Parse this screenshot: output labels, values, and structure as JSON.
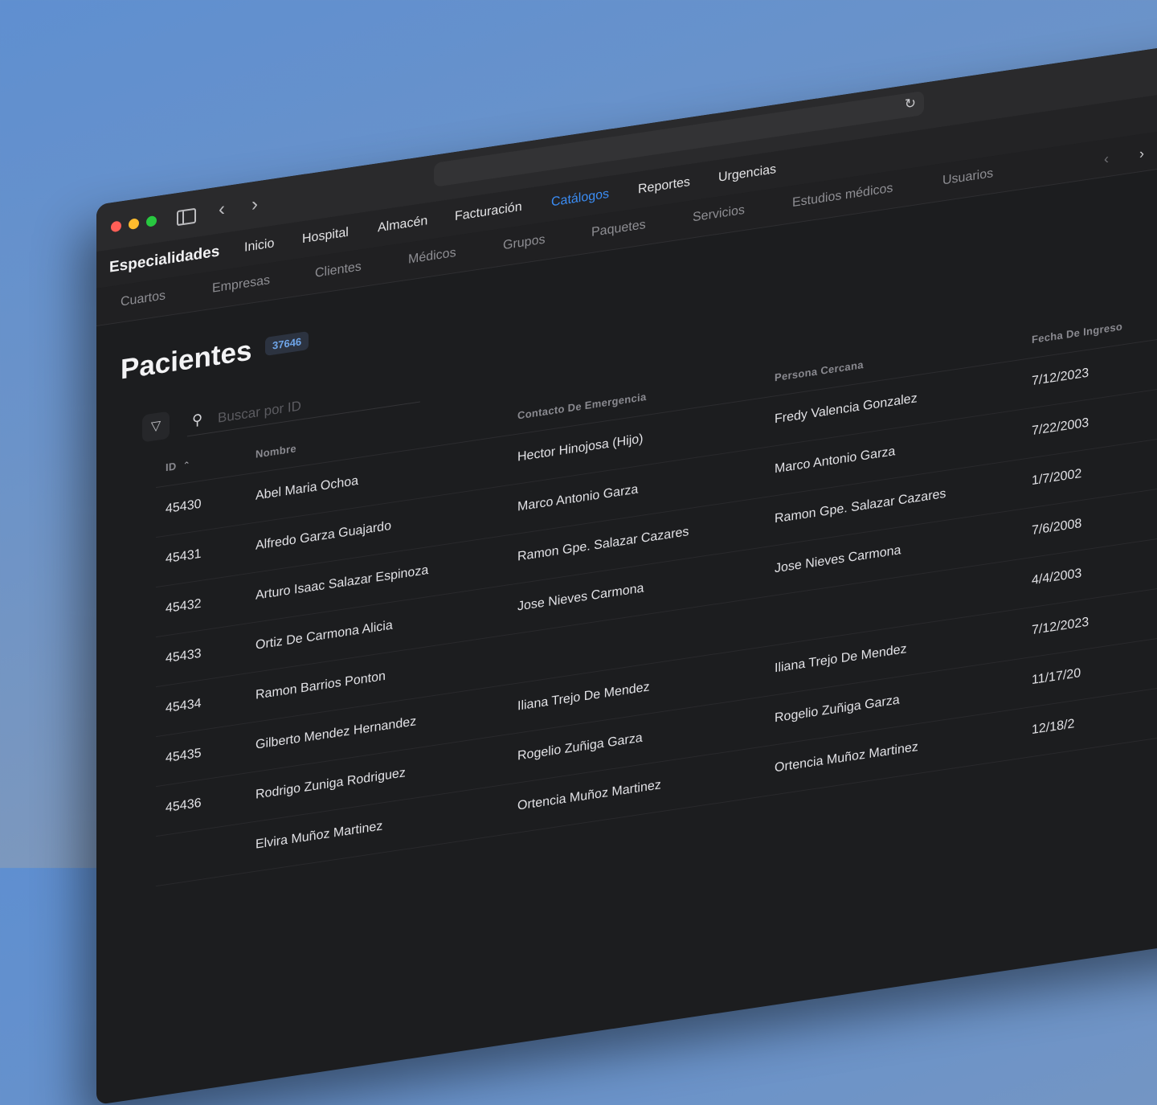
{
  "browser": {
    "url": ""
  },
  "nav_primary": {
    "brand": "Especialidades",
    "items": [
      {
        "label": "Inicio",
        "active": false
      },
      {
        "label": "Hospital",
        "active": false
      },
      {
        "label": "Almacén",
        "active": false
      },
      {
        "label": "Facturación",
        "active": false
      },
      {
        "label": "Catálogos",
        "active": true
      },
      {
        "label": "Reportes",
        "active": false
      },
      {
        "label": "Urgencias",
        "active": false
      }
    ]
  },
  "nav_secondary": {
    "items": [
      "Cuartos",
      "Empresas",
      "Clientes",
      "Médicos",
      "Grupos",
      "Paquetes",
      "Servicios",
      "Estudios médicos",
      "Usuarios"
    ]
  },
  "page": {
    "title": "Pacientes",
    "count": "37646"
  },
  "search": {
    "placeholder": "Buscar por ID"
  },
  "table": {
    "columns": {
      "id": "ID",
      "name": "Nombre",
      "contact": "Contacto De Emergencia",
      "person": "Persona Cercana",
      "date": "Fecha De Ingreso"
    },
    "rows": [
      {
        "id": "45430",
        "name": "Abel Maria Ochoa",
        "contact": "Hector Hinojosa (Hijo)",
        "person": "Fredy Valencia Gonzalez",
        "date": "7/12/2023"
      },
      {
        "id": "45431",
        "name": "Alfredo Garza Guajardo",
        "contact": "Marco Antonio Garza",
        "person": "Marco Antonio Garza",
        "date": "7/22/2003"
      },
      {
        "id": "45432",
        "name": "Arturo Isaac Salazar Espinoza",
        "contact": "Ramon Gpe. Salazar Cazares",
        "person": "Ramon Gpe. Salazar Cazares",
        "date": "1/7/2002"
      },
      {
        "id": "45433",
        "name": "Ortiz De Carmona Alicia",
        "contact": "Jose Nieves Carmona",
        "person": "Jose Nieves Carmona",
        "date": "7/6/2008"
      },
      {
        "id": "45434",
        "name": "Ramon Barrios Ponton",
        "contact": "",
        "person": "",
        "date": "4/4/2003"
      },
      {
        "id": "45435",
        "name": "Gilberto Mendez Hernandez",
        "contact": "Iliana Trejo De Mendez",
        "person": "Iliana Trejo De Mendez",
        "date": "7/12/2023"
      },
      {
        "id": "45436",
        "name": "Rodrigo Zuniga Rodriguez",
        "contact": "Rogelio Zuñiga Garza",
        "person": "Rogelio Zuñiga Garza",
        "date": "11/17/20"
      },
      {
        "id": "",
        "name": "Elvira Muñoz Martinez",
        "contact": "Ortencia Muñoz Martinez",
        "person": "Ortencia Muñoz Martinez",
        "date": "12/18/2"
      }
    ]
  }
}
